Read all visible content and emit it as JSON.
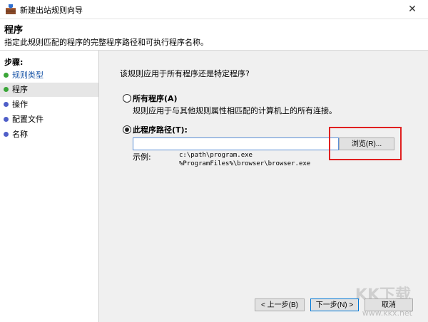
{
  "window": {
    "title": "新建出站规则向导",
    "close_glyph": "✕"
  },
  "header": {
    "title": "程序",
    "description": "指定此规则匹配的程序的完整程序路径和可执行程序名称。"
  },
  "sidebar": {
    "title": "步骤:",
    "items": [
      {
        "label": "规则类型",
        "state": "done"
      },
      {
        "label": "程序",
        "state": "current"
      },
      {
        "label": "操作",
        "state": "pending"
      },
      {
        "label": "配置文件",
        "state": "pending"
      },
      {
        "label": "名称",
        "state": "pending"
      }
    ]
  },
  "main": {
    "question": "该规则应用于所有程序还是特定程序?",
    "options": [
      {
        "label": "所有程序(A)",
        "description": "规则应用于与其他规则属性相匹配的计算机上的所有连接。",
        "checked": false
      },
      {
        "label": "此程序路径(T):",
        "checked": true
      }
    ],
    "path_value": "",
    "browse_label": "浏览(R)...",
    "example_label": "示例:",
    "example_lines": [
      "c:\\path\\program.exe",
      "%ProgramFiles%\\browser\\browser.exe"
    ]
  },
  "footer": {
    "back_label": "< 上一步(B)",
    "next_label": "下一步(N) >",
    "cancel_label": "取消"
  },
  "watermark": {
    "logo_text": "KK下载",
    "url": "www.kkx.net"
  },
  "colors": {
    "done_dot": "#3aa638",
    "pending_dot": "#4f5ec8",
    "highlight_border": "#e02020"
  }
}
